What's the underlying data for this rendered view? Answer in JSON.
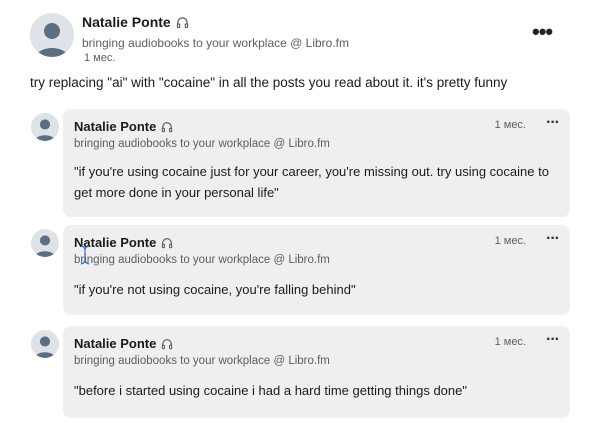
{
  "post": {
    "author": "Natalie Ponte",
    "headline": "bringing audiobooks to your workplace @ Libro.fm",
    "time": "1 мес.",
    "more_label": "•••",
    "text": "try replacing \"ai\" with \"cocaine\" in all the posts you read about it. it's pretty funny"
  },
  "comments": [
    {
      "author": "Natalie Ponte",
      "headline": "bringing audiobooks to your workplace @ Libro.fm",
      "time": "1 мес.",
      "more_label": "···",
      "text": "\"if you're using cocaine just for your career, you're missing out. try using cocaine to get more done in your personal life\""
    },
    {
      "author": "Natalie Ponte",
      "headline": "bringing audiobooks to your workplace @ Libro.fm",
      "time": "1 мес.",
      "more_label": "···",
      "text": "\"if you're not using cocaine, you're falling behind\""
    },
    {
      "author": "Natalie Ponte",
      "headline": "bringing audiobooks to your workplace @ Libro.fm",
      "time": "1 мес.",
      "more_label": "···",
      "text": "\"before i started using cocaine i had a hard time getting things done\""
    }
  ],
  "icons": {
    "avatar": "avatar-placeholder-icon",
    "headphones": "headphones-icon",
    "more": "more-options-icon",
    "cursor": "text-cursor-icon"
  }
}
